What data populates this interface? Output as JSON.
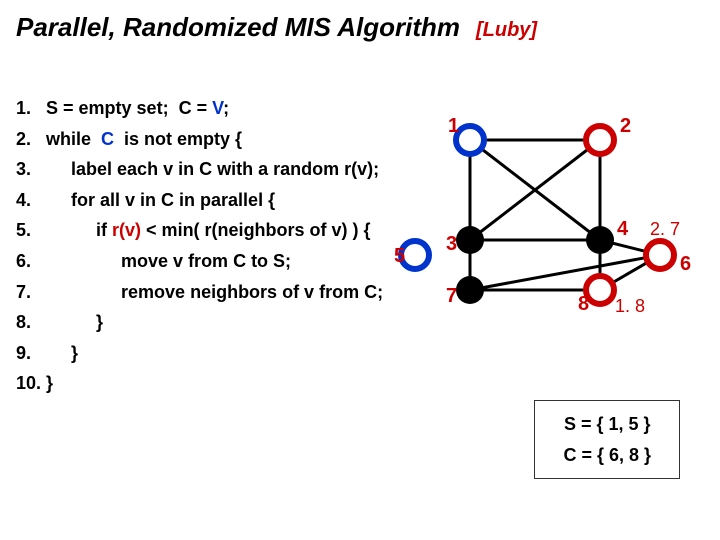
{
  "title": "Parallel, Randomized MIS Algorithm",
  "citation": "[Luby]",
  "algo": {
    "l1a": "1.   S = empty set;  C = ",
    "l1b": "V",
    "l1c": ";",
    "l2a": "2.   while  ",
    "l2b": "C",
    "l2c": "  is not empty {",
    "l3": "3.        label each v in C with a random r(v);",
    "l4": "4.        for all v in C in parallel {",
    "l5a": "5.             if ",
    "l5b": "r(v)",
    "l5c": " < min( r(neighbors of v) ) {",
    "l6": "6.                  move v from C to S;",
    "l7": "7.                  remove neighbors of v from C;",
    "l8": "8.             }",
    "l9": "9.        }",
    "l10": "10. }"
  },
  "graph": {
    "nodes": {
      "n1": "1",
      "n2": "2",
      "n3": "3",
      "n4": "4",
      "n5": "5",
      "n6": "6",
      "n7": "7",
      "n8": "8"
    },
    "r_labels": {
      "r6": "2. 7",
      "r8": "1. 8"
    }
  },
  "status": {
    "s_label": "S = { 1, 5 }",
    "c_label": "C = { 6, 8 }"
  }
}
